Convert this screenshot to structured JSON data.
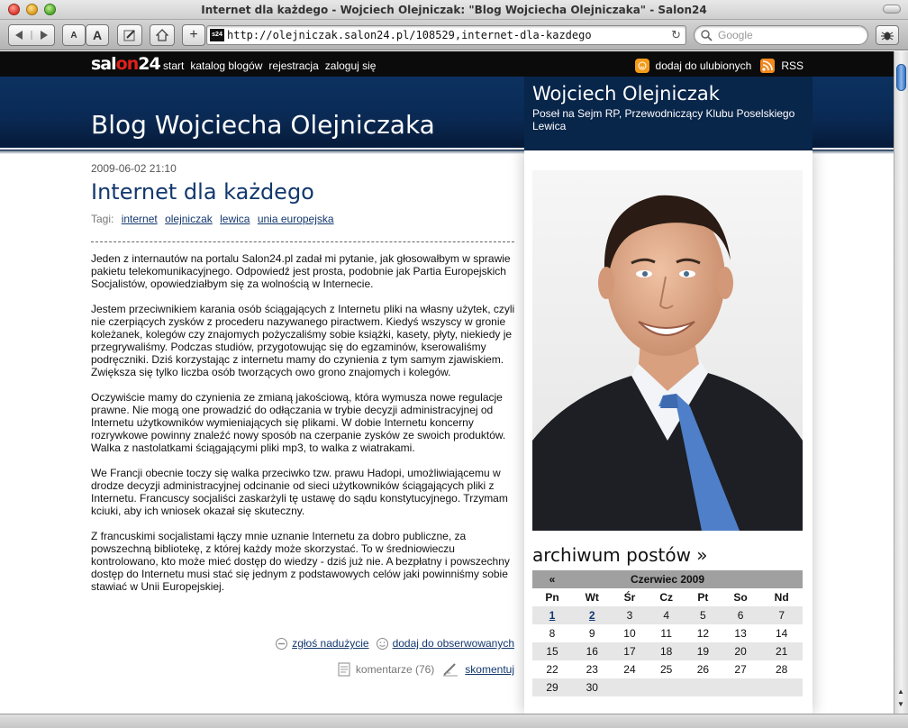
{
  "browser": {
    "window_title": "Internet dla każdego - Wojciech Olejniczak: \"Blog Wojciecha Olejniczaka\" - Salon24",
    "url": "http://olejniczak.salon24.pl/108529,internet-dla-kazdego",
    "favicon_text": "s24",
    "search_placeholder": "Google",
    "font_small": "A",
    "font_large": "A",
    "add_label": "+"
  },
  "site": {
    "logo_pre": "sal",
    "logo_on": "on",
    "logo_post": "24",
    "nav": [
      "start",
      "katalog blogów",
      "rejestracja",
      "zaloguj się"
    ],
    "favorites": "dodaj do ulubionych",
    "rss": "RSS"
  },
  "header": {
    "blog_title": "Blog Wojciecha Olejniczaka",
    "author_name": "Wojciech Olejniczak",
    "author_desc": "Poseł na Sejm RP, Przewodniczący Klubu Poselskiego Lewica"
  },
  "article": {
    "date": "2009-06-02 21:10",
    "title": "Internet dla każdego",
    "tags_label": "Tagi:",
    "tags": [
      "internet",
      "olejniczak",
      "lewica",
      "unia europejska"
    ],
    "paragraphs": [
      "Jeden z internautów na portalu Salon24.pl zadał mi pytanie, jak głosowałbym w sprawie pakietu telekomunikacyjnego. Odpowiedź jest prosta, podobnie jak Partia Europejskich Socjalistów, opowiedziałbym się za wolnością w Internecie.",
      "Jestem przeciwnikiem karania osób ściągających z Internetu pliki na własny użytek, czyli nie czerpiących zysków z procederu nazywanego piractwem. Kiedyś wszyscy w gronie koleżanek, kolegów czy znajomych pożyczaliśmy sobie książki, kasety, płyty, niekiedy je przegrywaliśmy. Podczas studiów, przygotowując się do egzaminów, kserowaliśmy podręczniki. Dziś korzystając z internetu mamy do czynienia z tym samym zjawiskiem. Zwiększa się tylko liczba osób tworzących owo grono znajomych i kolegów.",
      "Oczywiście mamy do czynienia ze zmianą jakościową, która wymusza nowe regulacje prawne. Nie mogą one prowadzić do odłączania w trybie decyzji administracyjnej od Internetu użytkowników wymieniających się plikami. W dobie Internetu koncerny rozrywkowe powinny znaleźć nowy sposób na czerpanie zysków ze swoich produktów. Walka z nastolatkami ściągającymi pliki mp3, to walka z wiatrakami.",
      "We Francji obecnie toczy się walka przeciwko tzw. prawu Hadopi, umożliwiającemu w drodze decyzji administracyjnej odcinanie od sieci użytkowników ściągających pliki z Internetu. Francuscy socjaliści zaskarżyli tę ustawę do sądu konstytucyjnego. Trzymam kciuki, aby ich wniosek okazał się skuteczny.",
      "Z francuskimi socjalistami łączy mnie uznanie Internetu za dobro publiczne, za powszechną bibliotekę, z której każdy może skorzystać. To w średniowieczu kontrolowano, kto może mieć dostęp do wiedzy - dziś już nie. A bezpłatny i powszechny dostęp do Internetu musi stać się jednym z podstawowych celów jaki powinniśmy sobie stawiać w Unii Europejskiej."
    ],
    "report_abuse": "zgłoś nadużycie",
    "add_watch": "dodaj do obserwowanych",
    "comments": "komentarze (76)",
    "comment_action": "skomentuj"
  },
  "sidebar": {
    "archive_title": "archiwum postów »",
    "calendar": {
      "prev": "«",
      "month": "Czerwiec 2009",
      "weekdays": [
        "Pn",
        "Wt",
        "Śr",
        "Cz",
        "Pt",
        "So",
        "Nd"
      ],
      "weeks": [
        [
          "1",
          "2",
          "3",
          "4",
          "5",
          "6",
          "7"
        ],
        [
          "8",
          "9",
          "10",
          "11",
          "12",
          "13",
          "14"
        ],
        [
          "15",
          "16",
          "17",
          "18",
          "19",
          "20",
          "21"
        ],
        [
          "22",
          "23",
          "24",
          "25",
          "26",
          "27",
          "28"
        ],
        [
          "29",
          "30",
          "",
          "",
          "",
          "",
          ""
        ]
      ],
      "linked_days": [
        "1",
        "2"
      ]
    }
  },
  "colors": {
    "banner": "#0c3160",
    "link": "#13386e",
    "logo_accent": "#e0201b"
  }
}
